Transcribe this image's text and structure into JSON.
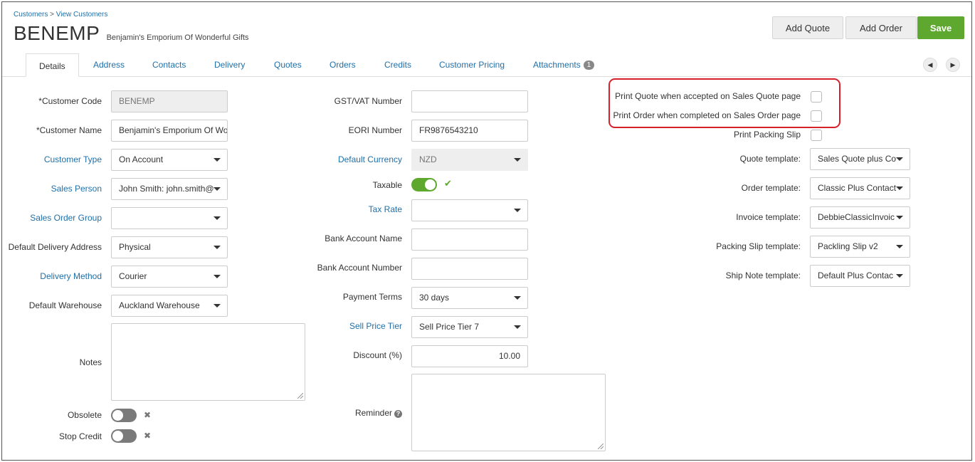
{
  "breadcrumb": {
    "root": "Customers",
    "separator": ">",
    "current": "View Customers"
  },
  "header": {
    "title": "BENEMP",
    "subtitle": "Benjamin's Emporium Of Wonderful Gifts",
    "add_quote_label": "Add Quote",
    "add_order_label": "Add Order",
    "save_label": "Save"
  },
  "tabs": [
    {
      "label": "Details",
      "active": true
    },
    {
      "label": "Address"
    },
    {
      "label": "Contacts"
    },
    {
      "label": "Delivery"
    },
    {
      "label": "Quotes"
    },
    {
      "label": "Orders"
    },
    {
      "label": "Credits"
    },
    {
      "label": "Customer Pricing"
    },
    {
      "label": "Attachments",
      "badge": "1"
    }
  ],
  "left": {
    "customer_code": {
      "label": "*Customer Code",
      "value": "BENEMP"
    },
    "customer_name": {
      "label": "*Customer Name",
      "value": "Benjamin's Emporium Of Wonderful Gifts"
    },
    "customer_type": {
      "label": "Customer Type",
      "value": "On Account"
    },
    "sales_person": {
      "label": "Sales Person",
      "value": "John Smith: john.smith@"
    },
    "sales_order_group": {
      "label": "Sales Order Group",
      "value": ""
    },
    "default_delivery_address": {
      "label": "Default Delivery Address",
      "value": "Physical"
    },
    "delivery_method": {
      "label": "Delivery Method",
      "value": "Courier"
    },
    "default_warehouse": {
      "label": "Default Warehouse",
      "value": "Auckland Warehouse"
    },
    "notes": {
      "label": "Notes"
    },
    "obsolete": {
      "label": "Obsolete",
      "on": false
    },
    "stop_credit": {
      "label": "Stop Credit",
      "on": false
    }
  },
  "middle": {
    "gst_vat": {
      "label": "GST/VAT Number",
      "value": ""
    },
    "eori": {
      "label": "EORI Number",
      "value": "FR9876543210"
    },
    "default_currency": {
      "label": "Default Currency",
      "value": "NZD"
    },
    "taxable": {
      "label": "Taxable",
      "on": true
    },
    "tax_rate": {
      "label": "Tax Rate",
      "value": ""
    },
    "bank_account_name": {
      "label": "Bank Account Name",
      "value": ""
    },
    "bank_account_number": {
      "label": "Bank Account Number",
      "value": ""
    },
    "payment_terms": {
      "label": "Payment Terms",
      "value": "30 days"
    },
    "sell_price_tier": {
      "label": "Sell Price Tier",
      "value": "Sell Price Tier 7"
    },
    "discount": {
      "label": "Discount (%)",
      "value": "10.00"
    },
    "reminder": {
      "label": "Reminder"
    }
  },
  "right": {
    "print_quote": {
      "label": "Print Quote when accepted on Sales Quote page",
      "checked": false
    },
    "print_order": {
      "label": "Print Order when completed on Sales Order page",
      "checked": false
    },
    "print_packing_slip": {
      "label": "Print Packing Slip",
      "checked": false
    },
    "quote_template": {
      "label": "Quote template:",
      "value": "Sales Quote plus Co"
    },
    "order_template": {
      "label": "Order template:",
      "value": "Classic Plus Contact"
    },
    "invoice_template": {
      "label": "Invoice template:",
      "value": "DebbieClassicInvoic"
    },
    "packing_slip_template": {
      "label": "Packing Slip template:",
      "value": "Packling Slip v2"
    },
    "ship_note_template": {
      "label": "Ship Note template:",
      "value": "Default Plus Contac"
    }
  },
  "colors": {
    "accent": "#5ea830",
    "link": "#1f6fa8",
    "highlight": "#d8202a"
  },
  "icons": {
    "prev": "chevron-left-icon",
    "next": "chevron-right-icon",
    "check": "check-icon",
    "x": "x-icon",
    "help": "question-circle-icon"
  }
}
